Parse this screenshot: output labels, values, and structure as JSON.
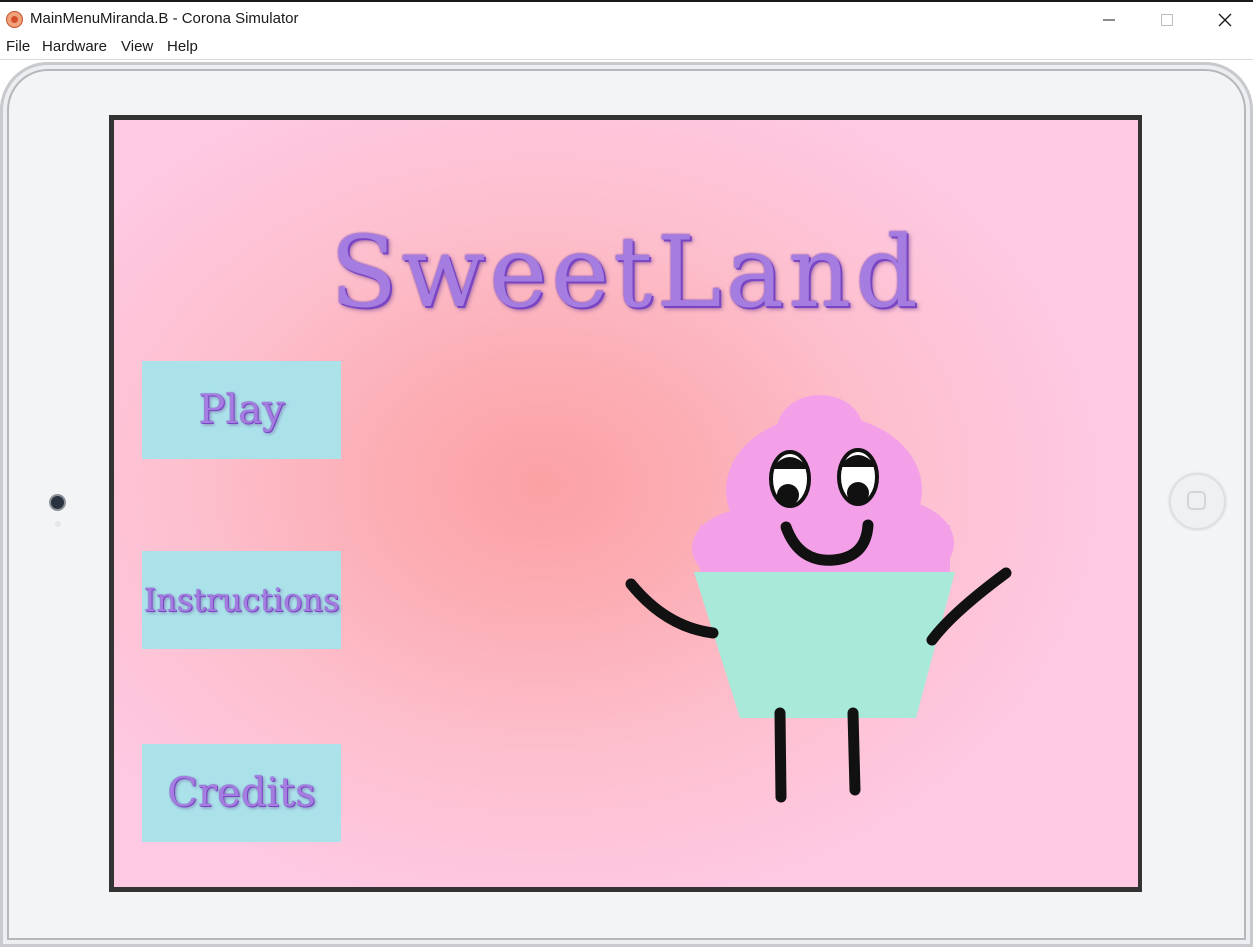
{
  "window": {
    "title": "MainMenuMiranda.B - Corona Simulator",
    "controls": {
      "minimize": "minimize-icon",
      "maximize": "maximize-icon",
      "close": "close-icon"
    }
  },
  "menubar": {
    "items": [
      "File",
      "Hardware",
      "View",
      "Help"
    ]
  },
  "game": {
    "title": "SweetLand",
    "buttons": {
      "play": "Play",
      "instructions": "Instructions",
      "credits": "Credits"
    },
    "colors": {
      "background_center": "#fba1a4",
      "background_edge": "#fec9e3",
      "button_fill": "#abe2ea",
      "text_purple": "#a57de0",
      "cupcake_frosting": "#f3a0e8",
      "cupcake_wrapper": "#a9e9d9"
    }
  }
}
